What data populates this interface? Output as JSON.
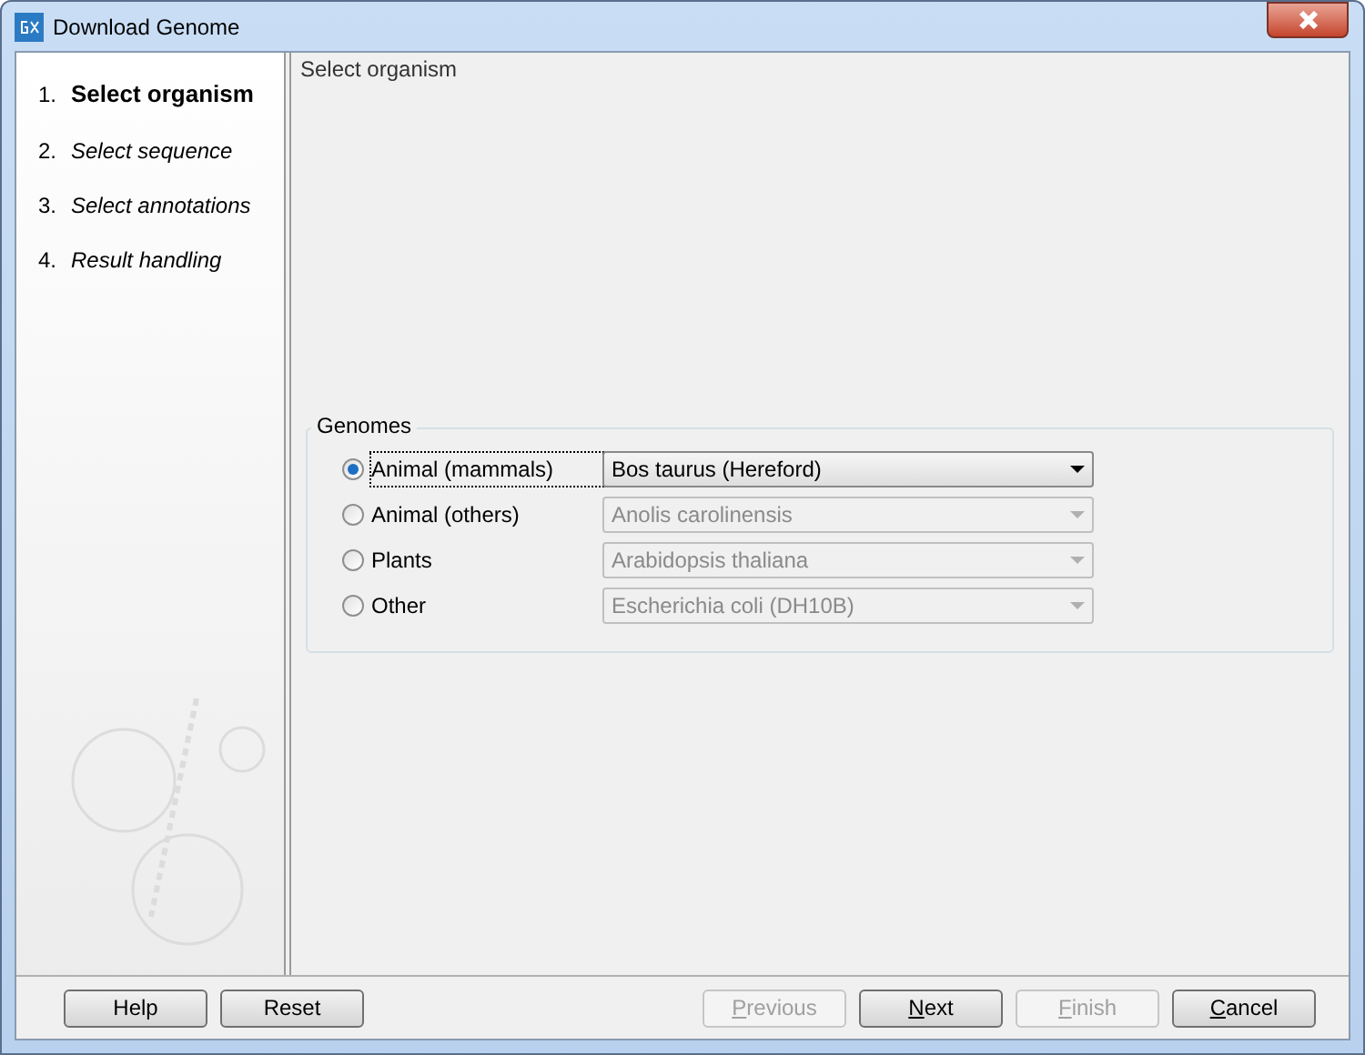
{
  "window": {
    "title": "Download Genome"
  },
  "steps": [
    {
      "number": "1.",
      "label": "Select organism",
      "selected": true
    },
    {
      "number": "2.",
      "label": "Select sequence",
      "selected": false
    },
    {
      "number": "3.",
      "label": "Select annotations",
      "selected": false
    },
    {
      "number": "4.",
      "label": "Result handling",
      "selected": false
    }
  ],
  "panel": {
    "heading": "Select organism"
  },
  "genomes": {
    "legend": "Genomes",
    "options": [
      {
        "label": "Animal (mammals)",
        "selected": true,
        "value": "Bos taurus (Hereford)"
      },
      {
        "label": "Animal (others)",
        "selected": false,
        "value": "Anolis carolinensis"
      },
      {
        "label": "Plants",
        "selected": false,
        "value": "Arabidopsis thaliana"
      },
      {
        "label": "Other",
        "selected": false,
        "value": "Escherichia coli (DH10B)"
      }
    ]
  },
  "buttons_left": [
    {
      "label": "Help",
      "disabled": false,
      "mnemonic": false
    },
    {
      "label": "Reset",
      "disabled": false,
      "mnemonic": false
    }
  ],
  "buttons_right": [
    {
      "label": "Previous",
      "disabled": true,
      "mnemonic": true
    },
    {
      "label": "Next",
      "disabled": false,
      "mnemonic": true
    },
    {
      "label": "Finish",
      "disabled": true,
      "mnemonic": true
    },
    {
      "label": "Cancel",
      "disabled": false,
      "mnemonic": true
    }
  ]
}
